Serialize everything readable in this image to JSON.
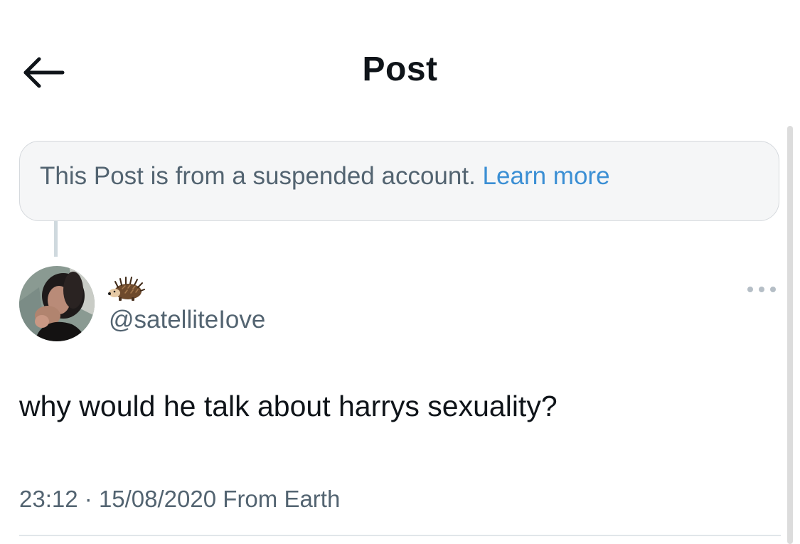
{
  "header": {
    "back_icon": "arrow-left-icon",
    "title": "Post"
  },
  "notice": {
    "text": "This Post is from a suspended account.",
    "link": "Learn more"
  },
  "post": {
    "author": {
      "display_name_icon": "hedgehog-emoji",
      "handle": "@satelliteIove"
    },
    "more_icon": "more-dots-icon",
    "text": "why would he talk about harrys sexuality?",
    "time": "23:12",
    "separator": "·",
    "date": "15/08/2020",
    "source": "From Earth"
  }
}
